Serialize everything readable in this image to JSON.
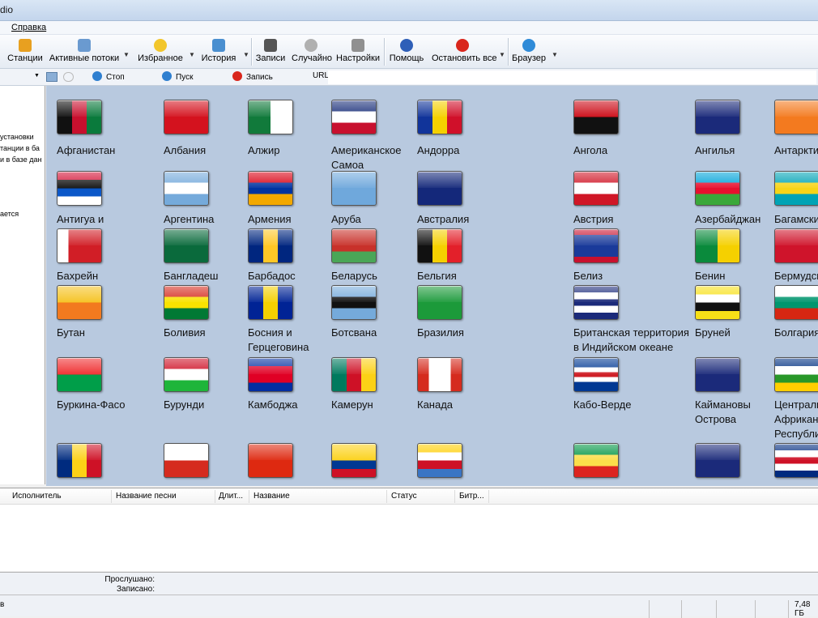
{
  "window": {
    "title_fragment": "dio"
  },
  "menu": {
    "items": [
      "Справка"
    ]
  },
  "toolbar": {
    "items": [
      {
        "label": "Станции",
        "icon": "stations-icon",
        "color": "#e8a020",
        "dropdown": false
      },
      {
        "label": "Активные потоки",
        "icon": "active-streams-icon",
        "color": "#6a9ad0",
        "dropdown": true
      },
      {
        "label": "Избранное",
        "icon": "favorites-star-icon",
        "color": "#f2c62b",
        "dropdown": true
      },
      {
        "label": "История",
        "icon": "history-icon",
        "color": "#4a8fd0",
        "dropdown": true
      },
      {
        "label": "Записи",
        "icon": "recordings-icon",
        "color": "#555555",
        "dropdown": false
      },
      {
        "label": "Случайно",
        "icon": "random-icon",
        "color": "#b0b0b0",
        "dropdown": false
      },
      {
        "label": "Настройки",
        "icon": "settings-wrench-icon",
        "color": "#909090",
        "dropdown": false
      },
      {
        "label": "Помощь",
        "icon": "help-icon",
        "color": "#2e5fb8",
        "dropdown": false
      },
      {
        "label": "Остановить все",
        "icon": "stop-all-icon",
        "color": "#d9261c",
        "dropdown": true
      },
      {
        "label": "Браузер",
        "icon": "browser-icon",
        "color": "#2f8bd8",
        "dropdown": true
      }
    ]
  },
  "controls": {
    "stop": "Стоп",
    "play": "Пуск",
    "record": "Запись",
    "url_label": "URL",
    "url_value": ""
  },
  "left_panel": {
    "lines": [
      "установки",
      "танции в ба",
      "и в базе дан",
      "ается"
    ]
  },
  "flags": [
    {
      "name": "Афганистан",
      "bands": [
        "#111111",
        "#c8102e",
        "#0a7a3c"
      ],
      "dir": "v"
    },
    {
      "name": "Албания",
      "bands": [
        "#d4121e"
      ],
      "dir": "h"
    },
    {
      "name": "Алжир",
      "bands": [
        "#117a3b",
        "#ffffff"
      ],
      "dir": "v"
    },
    {
      "name": "Американское Самоа",
      "bands": [
        "#1a2f7a",
        "#ffffff",
        "#c8102e"
      ],
      "dir": "h"
    },
    {
      "name": "Андорра",
      "bands": [
        "#11349a",
        "#f5d000",
        "#d0102a"
      ],
      "dir": "v"
    },
    {
      "name": "Ангола",
      "bands": [
        "#cc0a16",
        "#111111"
      ],
      "dir": "h"
    },
    {
      "name": "Ангилья",
      "bands": [
        "#1b2a7a"
      ],
      "dir": "h"
    },
    {
      "name": "Антарктида",
      "bands": [
        "#f37a1f"
      ],
      "dir": "h"
    },
    {
      "name": "Антигуа и Барбуда",
      "bands": [
        "#d21034",
        "#111111",
        "#0b57c8",
        "#ffffff"
      ],
      "dir": "h"
    },
    {
      "name": "Аргентина",
      "bands": [
        "#75aadb",
        "#ffffff",
        "#75aadb"
      ],
      "dir": "h"
    },
    {
      "name": "Армения",
      "bands": [
        "#d90012",
        "#0033a0",
        "#f2a800"
      ],
      "dir": "h"
    },
    {
      "name": "Аруба",
      "bands": [
        "#6fa8dc"
      ],
      "dir": "h"
    },
    {
      "name": "Австралия",
      "bands": [
        "#14287a"
      ],
      "dir": "h"
    },
    {
      "name": "Австрия",
      "bands": [
        "#d01626",
        "#ffffff",
        "#d01626"
      ],
      "dir": "h"
    },
    {
      "name": "Азербайджан",
      "bands": [
        "#00a3d8",
        "#e8102e",
        "#3aa83a"
      ],
      "dir": "h"
    },
    {
      "name": "Багамские",
      "bands": [
        "#00a3b5",
        "#f7d417",
        "#00a3b5"
      ],
      "dir": "h"
    },
    {
      "name": "Бахрейн",
      "bands": [
        "#ffffff",
        "#d11e26",
        "#d11e26",
        "#d11e26"
      ],
      "dir": "v"
    },
    {
      "name": "Бангладеш",
      "bands": [
        "#0a6a3c"
      ],
      "dir": "h"
    },
    {
      "name": "Барбадос",
      "bands": [
        "#00267f",
        "#ffc726",
        "#00267f"
      ],
      "dir": "v"
    },
    {
      "name": "Беларусь",
      "bands": [
        "#c8312a",
        "#c8312a",
        "#4aa657"
      ],
      "dir": "h"
    },
    {
      "name": "Бельгия",
      "bands": [
        "#111111",
        "#f5d000",
        "#e3202a"
      ],
      "dir": "v"
    },
    {
      "name": "Белиз",
      "bands": [
        "#c8102e",
        "#1a3a9a",
        "#1a3a9a",
        "#1a3a9a",
        "#1a3a9a",
        "#c8102e"
      ],
      "dir": "h"
    },
    {
      "name": "Бенин",
      "bands": [
        "#0a8a3c",
        "#f5d000"
      ],
      "dir": "v"
    },
    {
      "name": "Бермудские",
      "bands": [
        "#cf142b"
      ],
      "dir": "h"
    },
    {
      "name": "Бутан",
      "bands": [
        "#f5c21f",
        "#f27a1f"
      ],
      "dir": "h"
    },
    {
      "name": "Боливия",
      "bands": [
        "#d52b1e",
        "#f9e300",
        "#007934"
      ],
      "dir": "h"
    },
    {
      "name": "Босния и Герцеговина",
      "bands": [
        "#002395",
        "#f5d000",
        "#002395"
      ],
      "dir": "v"
    },
    {
      "name": "Ботсвана",
      "bands": [
        "#75aadb",
        "#111111",
        "#75aadb"
      ],
      "dir": "h"
    },
    {
      "name": "Бразилия",
      "bands": [
        "#1c9a3a"
      ],
      "dir": "h"
    },
    {
      "name": "Британская территория в Индийском океане",
      "bands": [
        "#1b2a7a",
        "#ffffff",
        "#1b2a7a",
        "#ffffff",
        "#1b2a7a"
      ],
      "dir": "h"
    },
    {
      "name": "Бруней",
      "bands": [
        "#f7e017",
        "#ffffff",
        "#111111",
        "#f7e017"
      ],
      "dir": "h"
    },
    {
      "name": "Болгария",
      "bands": [
        "#ffffff",
        "#00966e",
        "#d62612"
      ],
      "dir": "h"
    },
    {
      "name": "Буркина-Фасо",
      "bands": [
        "#ef2b2d",
        "#009e49"
      ],
      "dir": "h"
    },
    {
      "name": "Бурунди",
      "bands": [
        "#ce1126",
        "#ffffff",
        "#1eb53a"
      ],
      "dir": "h"
    },
    {
      "name": "Камбоджа",
      "bands": [
        "#032ea1",
        "#e00025",
        "#e00025",
        "#032ea1"
      ],
      "dir": "h"
    },
    {
      "name": "Камерун",
      "bands": [
        "#007a5e",
        "#ce1126",
        "#fcd116"
      ],
      "dir": "v"
    },
    {
      "name": "Канада",
      "bands": [
        "#d52b1e",
        "#ffffff",
        "#ffffff",
        "#d52b1e"
      ],
      "dir": "v"
    },
    {
      "name": "Кабо-Верде",
      "bands": [
        "#003893",
        "#003893",
        "#ffffff",
        "#cf2027",
        "#ffffff",
        "#003893",
        "#003893"
      ],
      "dir": "h"
    },
    {
      "name": "Каймановы Острова",
      "bands": [
        "#1b2a7a"
      ],
      "dir": "h"
    },
    {
      "name": "Центральная Африканская Республика",
      "bands": [
        "#003082",
        "#ffffff",
        "#289728",
        "#ffce00"
      ],
      "dir": "h"
    },
    {
      "name": "",
      "bands": [
        "#002b7f",
        "#fcd116",
        "#ce1126"
      ],
      "dir": "v"
    },
    {
      "name": "",
      "bands": [
        "#ffffff",
        "#d52b1e"
      ],
      "dir": "h"
    },
    {
      "name": "",
      "bands": [
        "#de2910"
      ],
      "dir": "h"
    },
    {
      "name": "",
      "bands": [
        "#fcd116",
        "#fcd116",
        "#003893",
        "#ce1126"
      ],
      "dir": "h"
    },
    {
      "name": "",
      "bands": [
        "#ffce00",
        "#ffffff",
        "#ce1126",
        "#3a75c4"
      ],
      "dir": "h"
    },
    {
      "name": "",
      "bands": [
        "#009543",
        "#fbde4a",
        "#dc241f"
      ],
      "dir": "h"
    },
    {
      "name": "",
      "bands": [
        "#1b2a7a"
      ],
      "dir": "h"
    },
    {
      "name": "",
      "bands": [
        "#002b7f",
        "#ffffff",
        "#ce1126",
        "#ffffff",
        "#002b7f"
      ],
      "dir": "h"
    }
  ],
  "tracklist": {
    "columns": [
      "Исполнитель",
      "Название песни",
      "Длит...",
      "Название",
      "Статус",
      "Битр..."
    ]
  },
  "status": {
    "listened": "Прослушано:",
    "recorded": "Записано:",
    "left": "в",
    "size": "7,48 ГБ"
  }
}
